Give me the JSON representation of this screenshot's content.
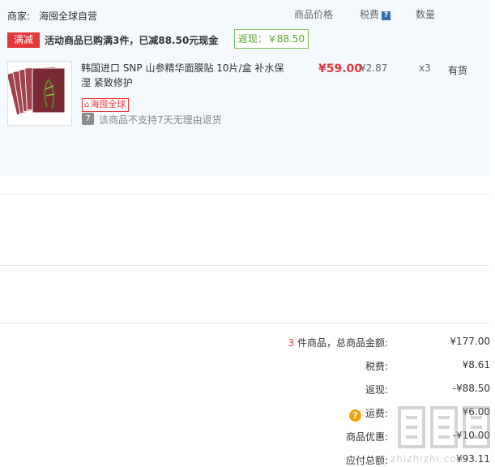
{
  "merchant": {
    "label": "商家:",
    "name": "海囤全球自营"
  },
  "columns": {
    "price": "商品价格",
    "tax": "税费",
    "tax_help": "?",
    "quantity": "数量"
  },
  "promotion": {
    "tag": "满减",
    "text": "活动商品已购满3件，已减88.50元现金",
    "rebate": "返现：￥88.50"
  },
  "item": {
    "title": "韩国进口 SNP 山参精华面膜贴 10片/盒 补水保湿 紧致修护",
    "brand_tag": "海囤全球",
    "return_badge": "7",
    "return_note": "该商品不支持7天无理由退货",
    "price": "¥59.00",
    "tax": "¥2.87",
    "quantity": "x3",
    "stock": "有货"
  },
  "summary": {
    "count": "3",
    "total_label": " 件商品，总商品金额:",
    "total_value": "¥177.00",
    "tax_label": "税费:",
    "tax_value": "¥8.61",
    "rebate_label": "返现:",
    "rebate_value": "-¥88.50",
    "shipping_help": "?",
    "shipping_label": "运费:",
    "shipping_value": "¥6.00",
    "discount_label": "商品优惠:",
    "discount_value": "-¥10.00",
    "payable_label": "应付总额:",
    "payable_value": "¥93.11"
  },
  "watermark": "zhizhizhi.com",
  "colors": {
    "panel_bg": "#f3f9fd",
    "accent_red": "#e4393c",
    "rebate_green": "#58a22e",
    "tax_help_blue": "#2d6fb0",
    "shipping_help_orange": "#f3a20c"
  },
  "icons": [
    "tax-help-icon",
    "return-policy-icon",
    "shipping-help-icon",
    "global-brand-icon"
  ]
}
